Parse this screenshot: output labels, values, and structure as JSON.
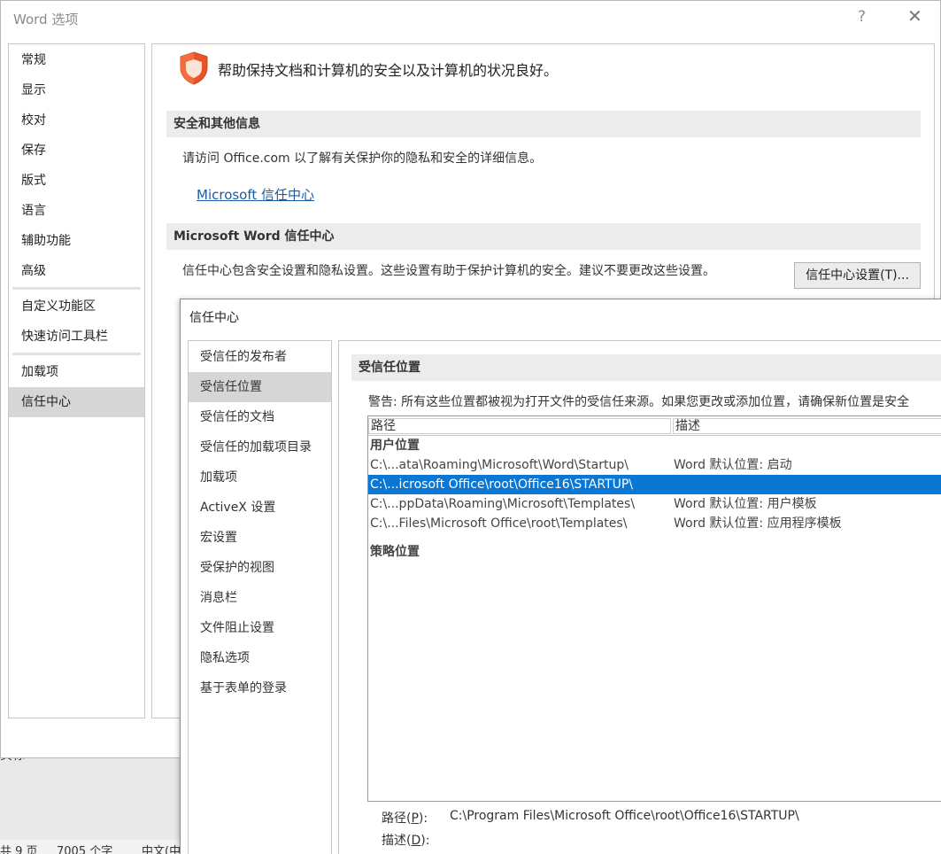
{
  "background": {
    "doc_text": "页标",
    "status": [
      "共 9 页",
      "7005 个字",
      "中文(中"
    ]
  },
  "options_window": {
    "title": "Word 选项",
    "help_glyph": "?",
    "close_glyph": "✕",
    "nav": {
      "group1": [
        "常规",
        "显示",
        "校对",
        "保存",
        "版式",
        "语言",
        "辅助功能",
        "高级"
      ],
      "group2": [
        "自定义功能区",
        "快速访问工具栏"
      ],
      "group3": [
        "加载项",
        "信任中心"
      ],
      "active": "信任中心"
    },
    "headline": "帮助保持文档和计算机的安全以及计算机的状况良好。",
    "section1": {
      "header": "安全和其他信息",
      "text": "请访问 Office.com 以了解有关保护你的隐私和安全的详细信息。",
      "link": "Microsoft 信任中心"
    },
    "section2": {
      "header": "Microsoft Word 信任中心",
      "text": "信任中心包含安全设置和隐私设置。这些设置有助于保护计算机的安全。建议不要更改这些设置。",
      "button": "信任中心设置(T)..."
    }
  },
  "trust_center": {
    "title": "信任中心",
    "nav": [
      "受信任的发布者",
      "受信任位置",
      "受信任的文档",
      "受信任的加载项目录",
      "加载项",
      "ActiveX 设置",
      "宏设置",
      "受保护的视图",
      "消息栏",
      "文件阻止设置",
      "隐私选项",
      "基于表单的登录"
    ],
    "active": "受信任位置",
    "section_header": "受信任位置",
    "warning": "警告: 所有这些位置都被视为打开文件的受信任来源。如果您更改或添加位置，请确保新位置是安全",
    "columns": [
      "路径",
      "描述"
    ],
    "user_group": "用户位置",
    "rows": [
      {
        "path": "C:\\...ata\\Roaming\\Microsoft\\Word\\Startup\\",
        "desc": "Word 默认位置: 启动"
      },
      {
        "path": "C:\\...icrosoft Office\\root\\Office16\\STARTUP\\",
        "desc": ""
      },
      {
        "path": "C:\\...ppData\\Roaming\\Microsoft\\Templates\\",
        "desc": "Word 默认位置: 用户模板"
      },
      {
        "path": "C:\\...Files\\Microsoft Office\\root\\Templates\\",
        "desc": "Word 默认位置: 应用程序模板"
      }
    ],
    "policy_group": "策略位置",
    "detail": {
      "path_label": "路径(",
      "path_key": "P",
      "path_suffix": "):",
      "path_value": "C:\\Program Files\\Microsoft Office\\root\\Office16\\STARTUP\\",
      "desc_label": "描述(",
      "desc_key": "D",
      "desc_suffix": "):"
    }
  },
  "colors": {
    "selected_row": "#0a77d4",
    "link": "#1a5ba6",
    "shield": "#e8532a"
  }
}
